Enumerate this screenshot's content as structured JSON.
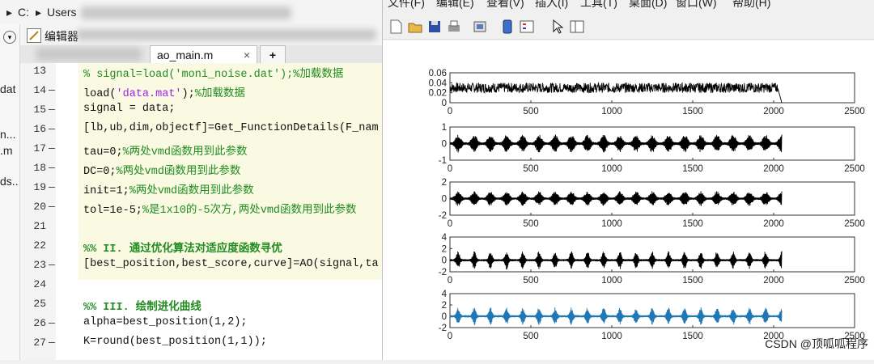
{
  "path_bar": {
    "arrow": "▸",
    "drive": "C:",
    "sep": "▸",
    "folder": "Users"
  },
  "left_panel": {
    "items": [
      "dat",
      "n...",
      ".m",
      "ds.."
    ]
  },
  "editor": {
    "edit_label": "编辑器",
    "active_tab": "ao_main.m",
    "close_glyph": "×",
    "add_tab": "+",
    "lines": [
      {
        "num": "13",
        "dash": "",
        "parts": [
          {
            "t": "% signal=load(",
            "c": "cm"
          },
          {
            "t": "'moni_noise.dat'",
            "c": "cm"
          },
          {
            "t": ");%加载数据",
            "c": "cm"
          }
        ]
      },
      {
        "num": "14",
        "dash": "—",
        "parts": [
          {
            "t": "load(",
            "c": ""
          },
          {
            "t": "'data.mat'",
            "c": "str"
          },
          {
            "t": ");",
            "c": ""
          },
          {
            "t": "%加载数据",
            "c": "cm"
          }
        ]
      },
      {
        "num": "15",
        "dash": "—",
        "parts": [
          {
            "t": "signal = data;",
            "c": ""
          }
        ]
      },
      {
        "num": "16",
        "dash": "—",
        "parts": [
          {
            "t": "[lb,ub,dim,objectf]=Get_FunctionDetails(F_nam",
            "c": ""
          }
        ]
      },
      {
        "num": "17",
        "dash": "—",
        "parts": [
          {
            "t": "tau=0;",
            "c": ""
          },
          {
            "t": "%两处vmd函数用到此参数",
            "c": "cm"
          }
        ]
      },
      {
        "num": "18",
        "dash": "—",
        "parts": [
          {
            "t": "DC=0;",
            "c": ""
          },
          {
            "t": "%两处vmd函数用到此参数",
            "c": "cm"
          }
        ]
      },
      {
        "num": "19",
        "dash": "—",
        "parts": [
          {
            "t": "init=1;",
            "c": ""
          },
          {
            "t": "%两处vmd函数用到此参数",
            "c": "cm"
          }
        ]
      },
      {
        "num": "20",
        "dash": "—",
        "parts": [
          {
            "t": "tol=1e-5;",
            "c": ""
          },
          {
            "t": "%是1x10的-5次方,两处vmd函数用到此参数",
            "c": "cm"
          }
        ]
      },
      {
        "num": "21",
        "dash": "",
        "parts": []
      },
      {
        "num": "22",
        "dash": "",
        "parts": [
          {
            "t": "%% II. 通过优化算法对适应度函数寻优",
            "c": "sec"
          }
        ]
      },
      {
        "num": "23",
        "dash": "—",
        "parts": [
          {
            "t": "[best_position,best_score,curve]=AO(signal,ta",
            "c": ""
          }
        ]
      },
      {
        "num": "24",
        "dash": "",
        "parts": []
      },
      {
        "num": "25",
        "dash": "",
        "parts": [
          {
            "t": "%% III. 绘制进化曲线",
            "c": "sec"
          }
        ]
      },
      {
        "num": "26",
        "dash": "—",
        "parts": [
          {
            "t": "alpha=best_position(1,2);",
            "c": ""
          }
        ]
      },
      {
        "num": "27",
        "dash": "—",
        "parts": [
          {
            "t": "K=round(best_position(1,1));",
            "c": ""
          }
        ]
      }
    ]
  },
  "figure": {
    "menu": [
      "文件(F)",
      "编辑(E)",
      "查看(V)",
      "插入(I)",
      "工具(T)",
      "桌面(D)",
      "窗口(W)",
      "帮助(H)"
    ],
    "toolbar_icons": [
      "new-file-icon",
      "open-folder-icon",
      "save-icon",
      "print-icon",
      "link-icon",
      "dock-icon",
      "legend-icon",
      "pointer-icon",
      "property-icon"
    ],
    "watermark": "CSDN @顶呱呱程序"
  },
  "chart_data": [
    {
      "type": "line",
      "title": "",
      "xlabel": "",
      "ylabel": "",
      "xlim": [
        0,
        2500
      ],
      "ylim": [
        0,
        0.06
      ],
      "x_ticks": [
        "0",
        "500",
        "1000",
        "1500",
        "2000",
        "2500"
      ],
      "y_ticks": [
        "0.06",
        "0.04",
        "0.02",
        "0"
      ],
      "series": [
        {
          "color": "#000000",
          "amplitude": 0.01,
          "center": 0.03,
          "pattern": "noise",
          "end": 2050
        }
      ]
    },
    {
      "type": "line",
      "title": "",
      "xlabel": "",
      "ylabel": "",
      "xlim": [
        0,
        2500
      ],
      "ylim": [
        -1,
        1
      ],
      "x_ticks": [
        "0",
        "500",
        "1000",
        "1500",
        "2000",
        "2500"
      ],
      "y_ticks": [
        "1",
        "0",
        "-1"
      ],
      "series": [
        {
          "color": "#000000",
          "amplitude": 0.55,
          "center": 0,
          "pattern": "bursts",
          "end": 2050
        }
      ]
    },
    {
      "type": "line",
      "title": "",
      "xlabel": "",
      "ylabel": "",
      "xlim": [
        0,
        2500
      ],
      "ylim": [
        -2,
        2
      ],
      "x_ticks": [
        "0",
        "500",
        "1000",
        "1500",
        "2000",
        "2500"
      ],
      "y_ticks": [
        "2",
        "0",
        "-2"
      ],
      "series": [
        {
          "color": "#000000",
          "amplitude": 0.9,
          "center": 0,
          "pattern": "bursts",
          "end": 2050
        }
      ]
    },
    {
      "type": "line",
      "title": "",
      "xlabel": "",
      "ylabel": "",
      "xlim": [
        0,
        2500
      ],
      "ylim": [
        -2,
        4
      ],
      "x_ticks": [
        "0",
        "500",
        "1000",
        "1500",
        "2000",
        "2500"
      ],
      "y_ticks": [
        "4",
        "2",
        "0",
        "-2"
      ],
      "series": [
        {
          "color": "#000000",
          "amplitude": 1.6,
          "center": 0,
          "pattern": "spikes",
          "end": 2050
        }
      ]
    },
    {
      "type": "line",
      "title": "",
      "xlabel": "",
      "ylabel": "",
      "xlim": [
        0,
        2500
      ],
      "ylim": [
        -2,
        4
      ],
      "x_ticks": [
        "0",
        "500",
        "1000",
        "1500",
        "2000",
        "2500"
      ],
      "y_ticks": [
        "4",
        "2",
        "0",
        "-2"
      ],
      "series": [
        {
          "color": "#1f77b4",
          "amplitude": 1.6,
          "center": 0,
          "pattern": "spikes",
          "end": 2050
        }
      ]
    }
  ]
}
